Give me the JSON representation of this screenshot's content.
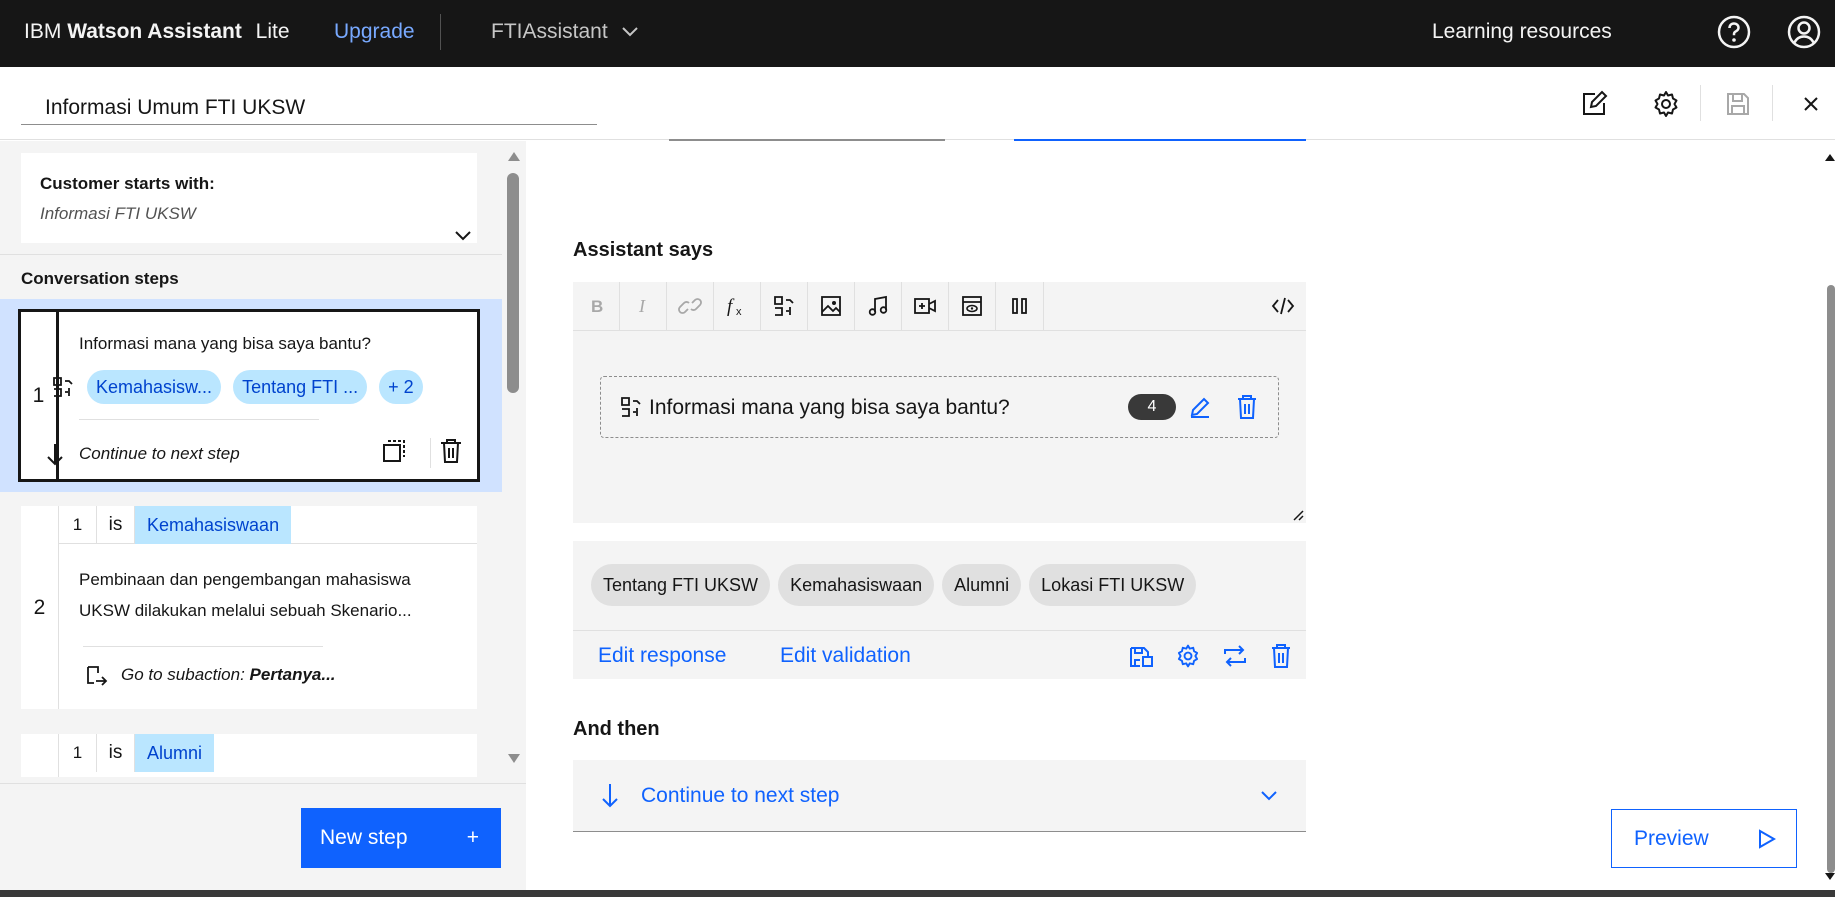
{
  "topbar": {
    "brand_prefix": "IBM",
    "brand_name": "Watson Assistant",
    "brand_plan": "Lite",
    "upgrade_label": "Upgrade",
    "assistant_name": "FTIAssistant",
    "learning_label": "Learning resources",
    "icons": [
      "help-icon",
      "user-profile-icon"
    ]
  },
  "action": {
    "name": "Informasi Umum FTI UKSW",
    "header_icons": [
      "edit-icon",
      "settings-icon",
      "save-icon",
      "close-icon"
    ]
  },
  "left_panel": {
    "trigger_title": "Customer starts with:",
    "trigger_value": "Informasi FTI UKSW",
    "steps_title": "Conversation steps",
    "steps": [
      {
        "number": "1",
        "text": "Informasi mana yang bisa saya bantu?",
        "chips": [
          "Kemahasisw...",
          "Tentang FTI ...",
          "+ 2"
        ],
        "footer": "Continue to next step"
      },
      {
        "number": "2",
        "condition_index": "1",
        "condition_op": "is",
        "condition_value": "Kemahasiswaan",
        "text": "Pembinaan dan pengembangan mahasiswa UKSW dilakukan melalui sebuah Skenario...",
        "footer_prefix": "Go to subaction:",
        "footer_target": "Pertanya..."
      },
      {
        "condition_index": "1",
        "condition_op": "is",
        "condition_value": "Alumni"
      }
    ],
    "new_step_label": "New step",
    "new_step_icon": "+"
  },
  "editor": {
    "assistant_says_title": "Assistant says",
    "toolbar": [
      "bold-icon",
      "italic-icon",
      "link-icon",
      "function-icon",
      "options-icon",
      "image-icon",
      "audio-icon",
      "video-icon",
      "iframe-icon",
      "pause-icon",
      "code-icon"
    ],
    "option_text": "Informasi mana yang bisa saya bantu?",
    "option_count": "4",
    "options": [
      "Tentang FTI UKSW",
      "Kemahasiswaan",
      "Alumni",
      "Lokasi FTI UKSW"
    ],
    "edit_response_label": "Edit response",
    "edit_validation_label": "Edit validation",
    "and_then_title": "And then",
    "and_then_value": "Continue to next step"
  },
  "preview_label": "Preview",
  "colors": {
    "topbar_bg": "#161616",
    "accent": "#0f62fe",
    "chip_blue": "#bae6ff",
    "selected_bg": "#d0e2ff",
    "panel_bg": "#f4f4f4"
  }
}
